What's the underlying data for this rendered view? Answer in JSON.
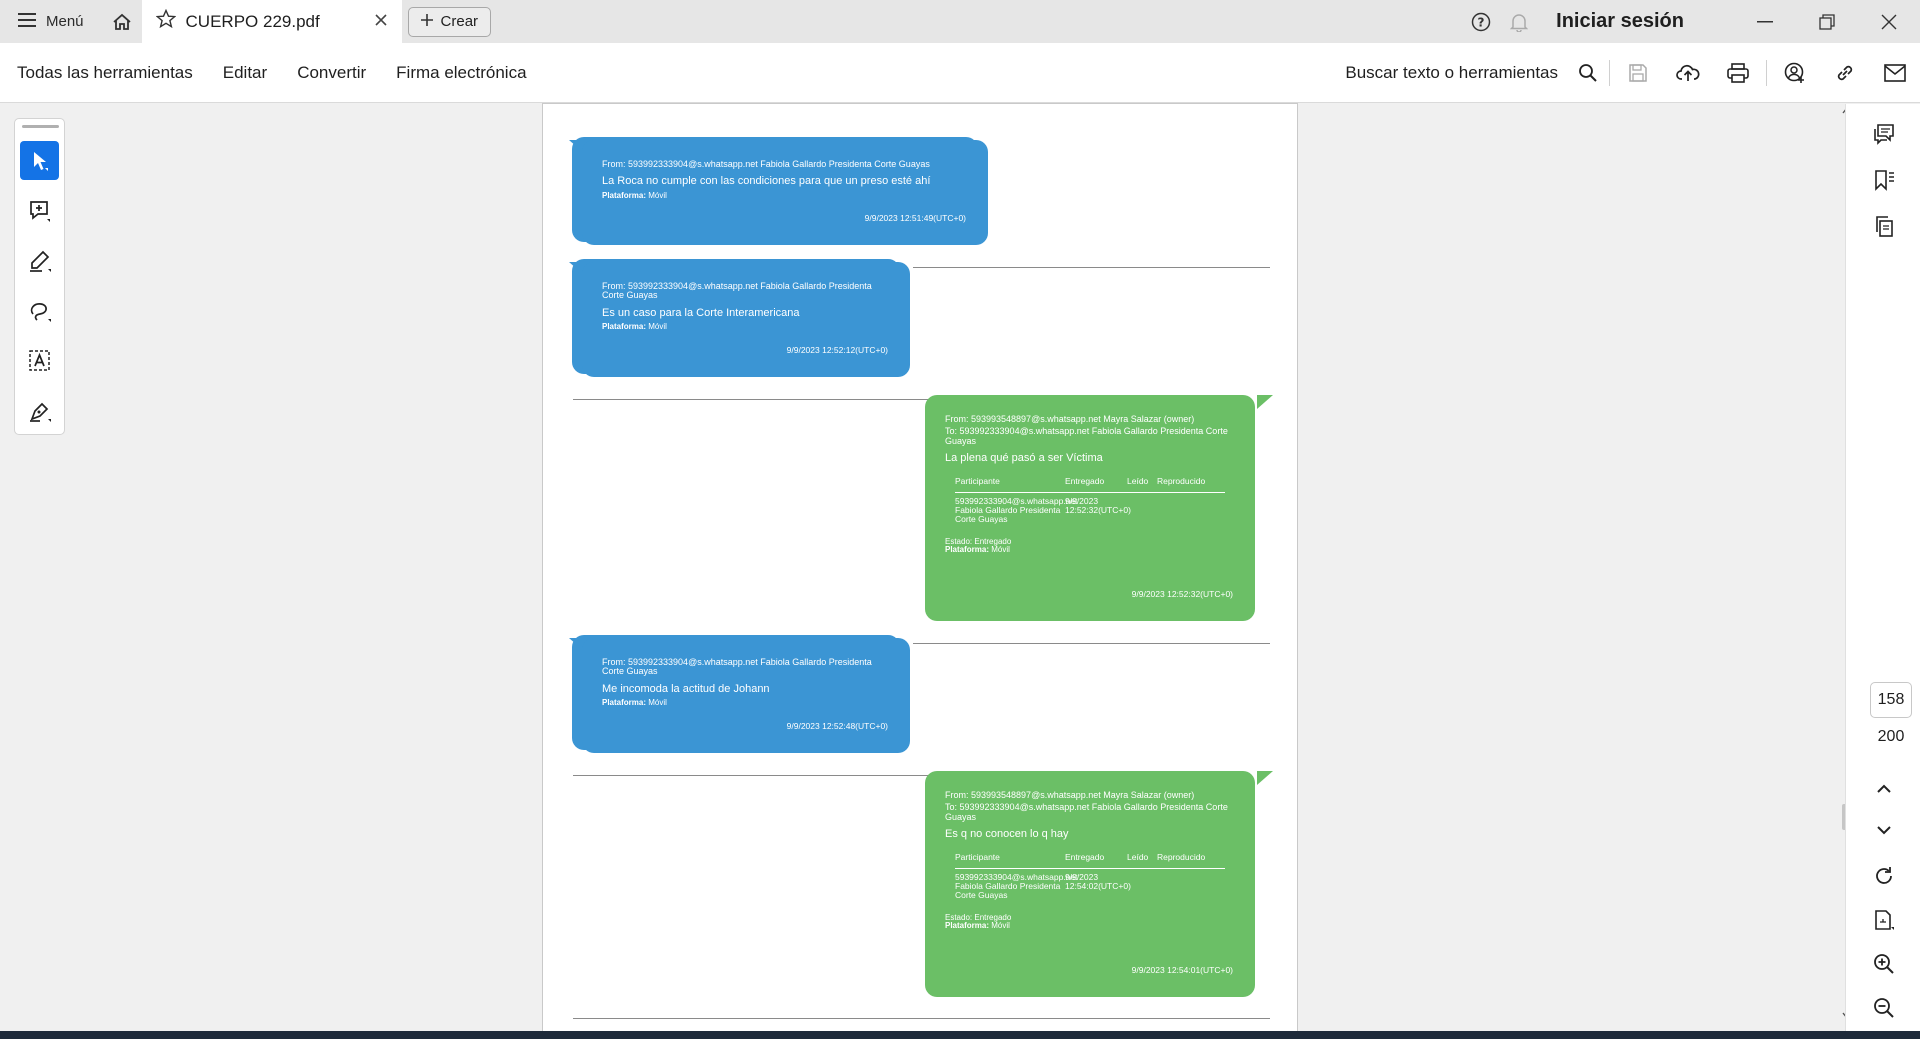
{
  "app": {
    "menu_label": "Menú",
    "tab_title": "CUERPO 229.pdf",
    "create_label": "Crear",
    "signin_label": "Iniciar sesión"
  },
  "toolbar": {
    "items": [
      "Todas las herramientas",
      "Editar",
      "Convertir",
      "Firma electrónica"
    ],
    "search_label": "Buscar texto o herramientas"
  },
  "navigation": {
    "current_page": "158",
    "total_pages": "200"
  },
  "messages": [
    {
      "side": "left",
      "from": "From: 593992333904@s.whatsapp.net Fabiola Gallardo Presidenta Corte Guayas",
      "text": "La Roca no cumple con las condiciones para que un preso esté ahí",
      "platform_label": "Plataforma:",
      "platform": "Móvil",
      "timestamp": "9/9/2023 12:51:49(UTC+0)"
    },
    {
      "side": "left",
      "from": "From: 593992333904@s.whatsapp.net Fabiola Gallardo Presidenta Corte Guayas",
      "text": "Es un caso para la Corte Interamericana",
      "platform_label": "Plataforma:",
      "platform": "Móvil",
      "timestamp": "9/9/2023 12:52:12(UTC+0)"
    },
    {
      "side": "right",
      "from": "From: 593993548897@s.whatsapp.net Mayra Salazar (owner)",
      "to": "To: 593992333904@s.whatsapp.net Fabiola Gallardo Presidenta Corte Guayas",
      "text": "La plena qué pasó a ser Víctima",
      "table_headers": [
        "Participante",
        "Entregado",
        "Leído",
        "Reproducido"
      ],
      "participant": "593992333904@s.whatsapp.net Fabiola Gallardo Presidenta Corte Guayas",
      "delivered": "9/9/2023 12:52:32(UTC+0)",
      "status_label": "Estado:",
      "status": "Entregado",
      "platform_label": "Plataforma:",
      "platform": "Móvil",
      "timestamp": "9/9/2023 12:52:32(UTC+0)"
    },
    {
      "side": "left",
      "from": "From: 593992333904@s.whatsapp.net Fabiola Gallardo Presidenta Corte Guayas",
      "text": "Me incomoda la actitud de Johann",
      "platform_label": "Plataforma:",
      "platform": "Móvil",
      "timestamp": "9/9/2023 12:52:48(UTC+0)"
    },
    {
      "side": "right",
      "from": "From: 593993548897@s.whatsapp.net Mayra Salazar (owner)",
      "to": "To: 593992333904@s.whatsapp.net Fabiola Gallardo Presidenta Corte Guayas",
      "text": "Es q no conocen lo q hay",
      "table_headers": [
        "Participante",
        "Entregado",
        "Leído",
        "Reproducido"
      ],
      "participant": "593992333904@s.whatsapp.net Fabiola Gallardo Presidenta Corte Guayas",
      "delivered": "9/9/2023 12:54:02(UTC+0)",
      "status_label": "Estado:",
      "status": "Entregado",
      "platform_label": "Plataforma:",
      "platform": "Móvil",
      "timestamp": "9/9/2023 12:54:01(UTC+0)"
    }
  ],
  "colors": {
    "blue_bubble": "#3b95d4",
    "green_bubble": "#6bbf66",
    "accent": "#1473e6"
  }
}
